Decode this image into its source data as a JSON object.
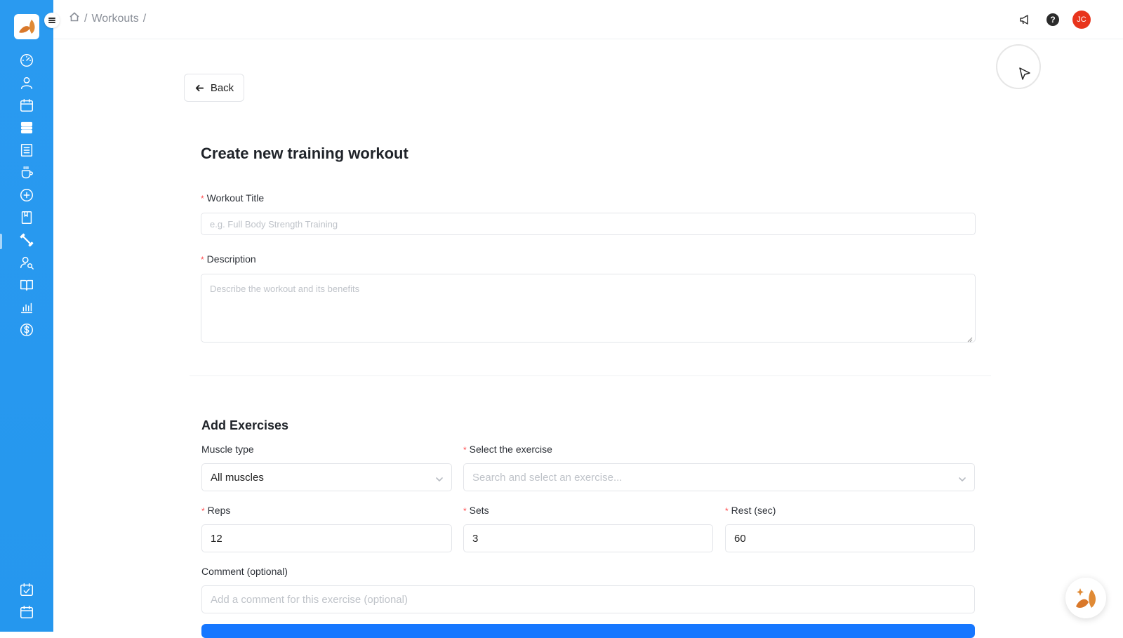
{
  "topbar": {
    "breadcrumb": {
      "home_icon": "home-icon",
      "sep1": "/",
      "section": "Workouts",
      "sep2": "/"
    },
    "notifications_icon": "megaphone-icon",
    "help_label": "?",
    "avatar_initials": "JC"
  },
  "sidebar": {
    "items": [
      {
        "name": "dashboard",
        "icon": "gauge-icon"
      },
      {
        "name": "clients",
        "icon": "user-icon"
      },
      {
        "name": "calendar",
        "icon": "calendar-icon"
      },
      {
        "name": "programs",
        "icon": "layout-icon"
      },
      {
        "name": "forms",
        "icon": "list-icon"
      },
      {
        "name": "nutrition",
        "icon": "cup-icon"
      },
      {
        "name": "habits",
        "icon": "refresh-plus-icon"
      },
      {
        "name": "resources",
        "icon": "bookmark-icon"
      },
      {
        "name": "workouts",
        "icon": "dumbbell-icon"
      },
      {
        "name": "leads",
        "icon": "user-search-icon"
      },
      {
        "name": "library",
        "icon": "book-icon"
      },
      {
        "name": "analytics",
        "icon": "bar-chart-icon"
      },
      {
        "name": "payments",
        "icon": "dollar-icon"
      }
    ],
    "bottom_items": [
      {
        "name": "tasks",
        "icon": "calendar-check-icon"
      },
      {
        "name": "schedule",
        "icon": "calendar-icon"
      }
    ],
    "active": "workouts"
  },
  "main": {
    "back_label": "Back",
    "title": "Create new training workout",
    "workout_title_label": "Workout Title",
    "workout_title_placeholder": "e.g. Full Body Strength Training",
    "description_label": "Description",
    "description_placeholder": "Describe the workout and its benefits",
    "add_exercises_title": "Add Exercises",
    "muscle_type_label": "Muscle type",
    "muscle_type_value": "All muscles",
    "select_exercise_label": "Select the exercise",
    "select_exercise_placeholder": "Search and select an exercise...",
    "reps_label": "Reps",
    "reps_value": "12",
    "sets_label": "Sets",
    "sets_value": "3",
    "rest_label": "Rest (sec)",
    "rest_value": "60",
    "comment_label": "Comment (optional)",
    "comment_placeholder": "Add a comment for this exercise (optional)",
    "required_mark": "*"
  },
  "colors": {
    "sidebar": "#2a9af0",
    "primary": "#1677ff",
    "avatar": "#e8341c",
    "required": "#ff4d4f"
  }
}
